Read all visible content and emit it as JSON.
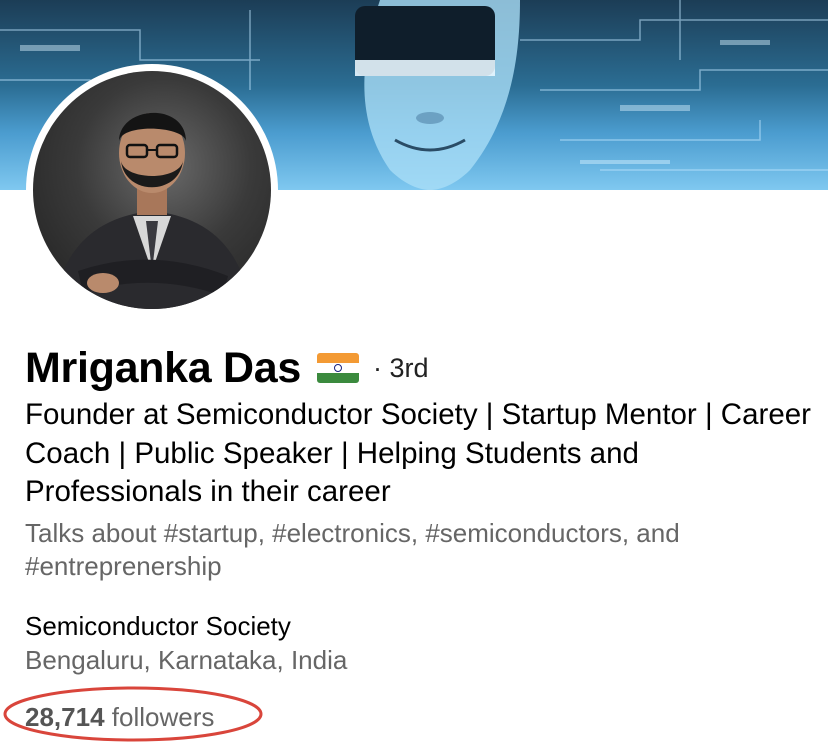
{
  "profile": {
    "name": "Mriganka Das",
    "flag_emoji": "India flag",
    "connection_degree": "· 3rd",
    "headline": "Founder at Semiconductor Society | Startup Mentor | Career Coach | Public Speaker | Helping Students and Professionals in their career",
    "talks_about": "Talks about #startup, #electronics, #semiconductors, and #entreprenership",
    "company": "Semiconductor Society",
    "location": "Bengaluru, Karnataka, India",
    "followers_count": "28,714",
    "followers_label": "followers"
  },
  "colors": {
    "annotation_circle": "#d9453b",
    "secondary_text": "#666666",
    "banner_accent": "#7fc8f0"
  },
  "icons": {
    "flag": "india-flag-icon",
    "banner": "vr-headset-banner-image",
    "avatar": "profile-photo"
  }
}
